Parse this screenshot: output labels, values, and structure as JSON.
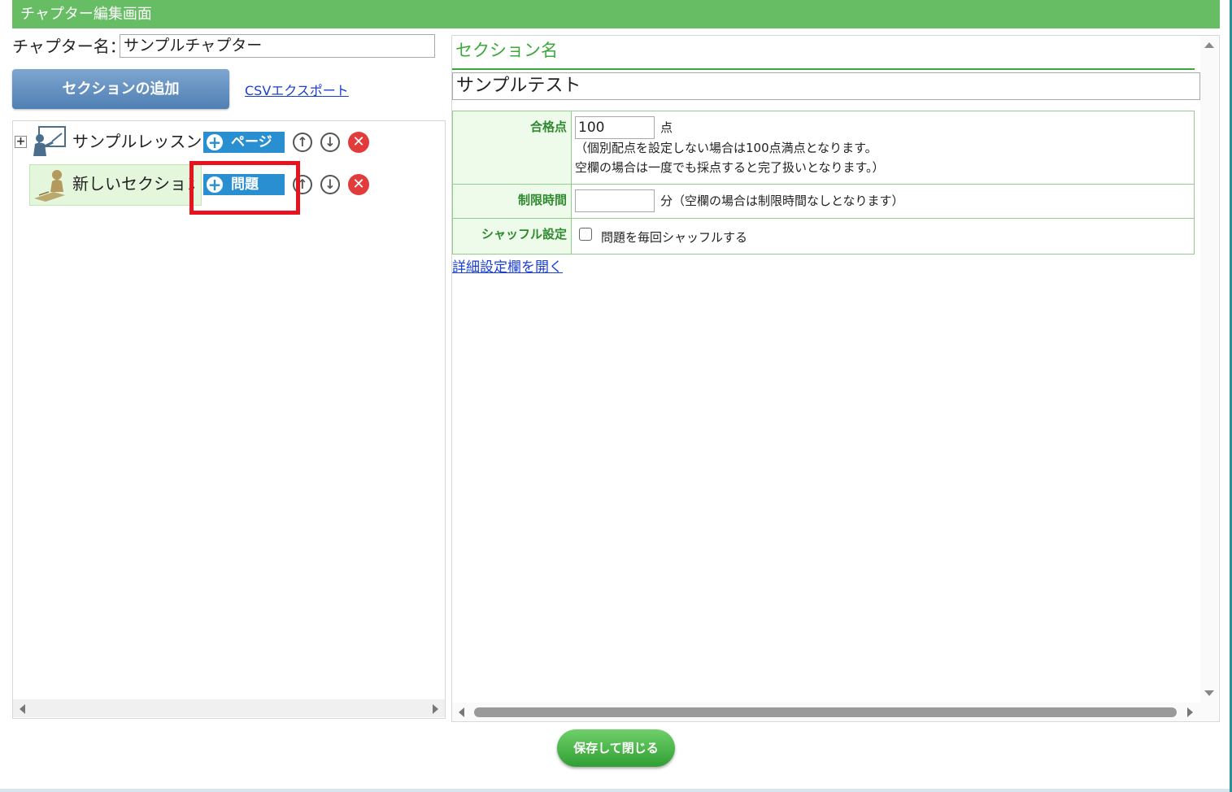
{
  "window": {
    "title": "チャプター編集画面"
  },
  "chapter": {
    "name_label": "チャプター名：",
    "name_value": "サンプルチャプター"
  },
  "toolbar": {
    "add_section_label": "セクションの追加",
    "csv_export_label": "CSVエクスポート"
  },
  "tree": {
    "expand_symbol": "+",
    "lesson": {
      "label": "サンプルレッスン",
      "add_button_label": "ページ",
      "icon": "lesson-presenter-icon"
    },
    "section": {
      "label": "新しいセクション",
      "add_button_label": "問題",
      "icon": "study-person-icon"
    },
    "icons": {
      "up": "↑",
      "down": "↓",
      "delete": "✕",
      "plus": "+"
    }
  },
  "editor": {
    "heading": "セクション名",
    "section_name_value": "サンプルテスト",
    "rows": {
      "passing_score": {
        "label": "合格点",
        "value": "100",
        "unit": "点",
        "note1": "（個別配点を設定しない場合は100点満点となります。",
        "note2": "空欄の場合は一度でも採点すると完了扱いとなります。）"
      },
      "time_limit": {
        "label": "制限時間",
        "value": "",
        "unit_note": "分（空欄の場合は制限時間なしとなります）"
      },
      "shuffle": {
        "label": "シャッフル設定",
        "checkbox_label": "問題を毎回シャッフルする",
        "checked": false
      }
    },
    "detail_link": "詳細設定欄を開く"
  },
  "footer": {
    "save_close_label": "保存して閉じる"
  },
  "colors": {
    "title_bar": "#67bd63",
    "accent_green": "#3aa83a",
    "add_button_blue": "#2a8fd0",
    "highlight_red": "#e8141d",
    "link_blue": "#1a3fd0"
  }
}
